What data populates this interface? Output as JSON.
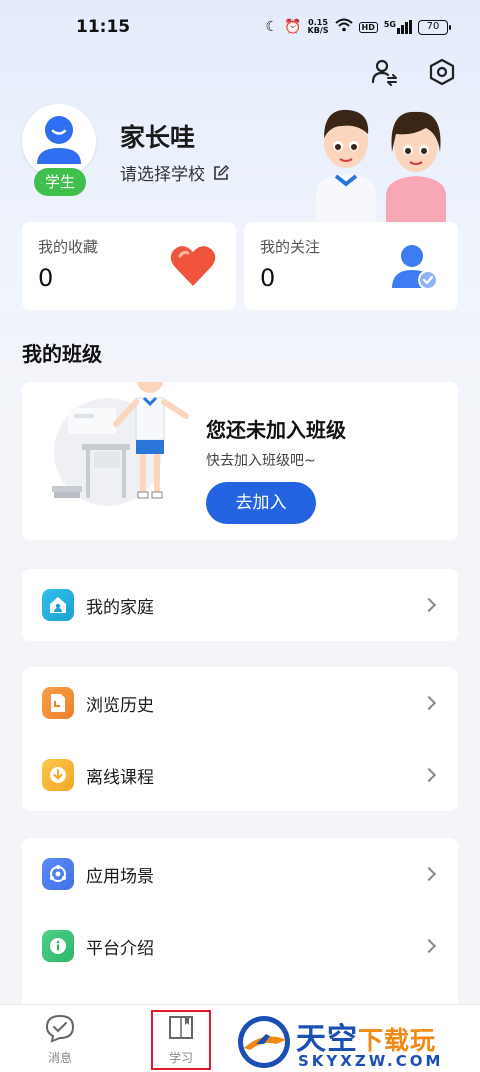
{
  "status_bar": {
    "time": "11:15",
    "net_speed_value": "0.15",
    "net_speed_unit": "KB/S",
    "hd": "HD",
    "signal_label": "5G",
    "battery": "70"
  },
  "profile": {
    "name": "家长哇",
    "school_prompt": "请选择学校",
    "role_badge": "学生"
  },
  "stats": {
    "favorites_label": "我的收藏",
    "favorites_value": "0",
    "follows_label": "我的关注",
    "follows_value": "0"
  },
  "my_class": {
    "section_title": "我的班级",
    "title": "您还未加入班级",
    "subtitle": "快去加入班级吧~",
    "join_button": "去加入"
  },
  "menu": {
    "family": "我的家庭",
    "history": "浏览历史",
    "offline": "离线课程",
    "scenes": "应用场景",
    "platform": "平台介绍"
  },
  "bottom_nav": {
    "messages": "消息",
    "study": "学习"
  },
  "watermark": {
    "main_cn_blue": "天空",
    "main_cn_orange": "下载玩",
    "domain": "SKYXZW.COM"
  },
  "colors": {
    "primary": "#2464e0",
    "role_badge": "#3fbf4c",
    "heart": "#f0543c"
  }
}
